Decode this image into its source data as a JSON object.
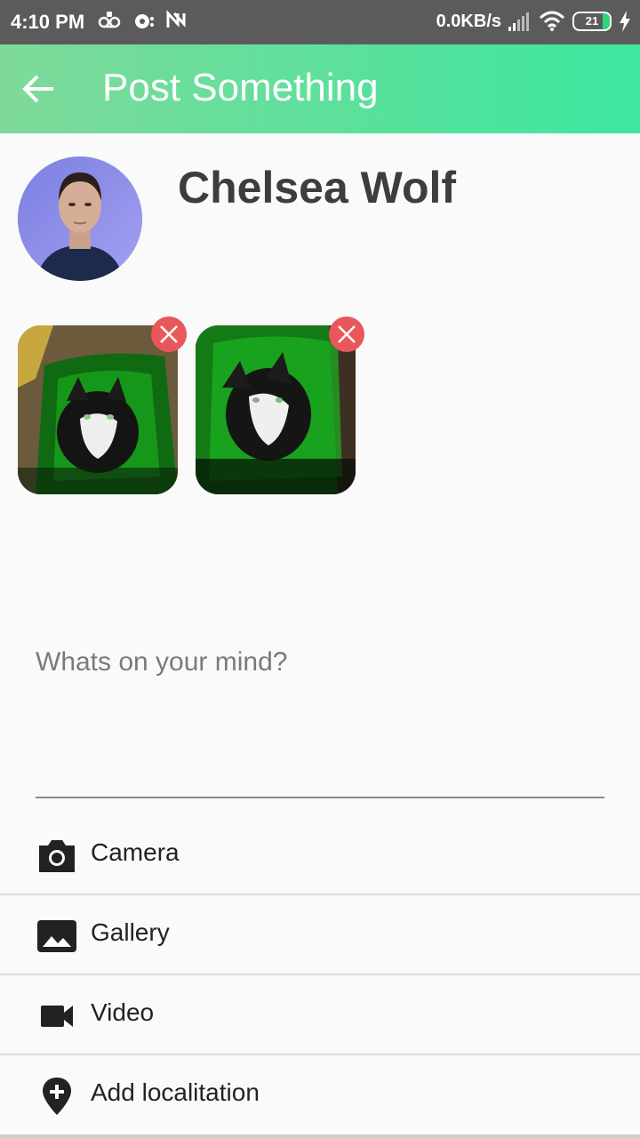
{
  "status_bar": {
    "time": "4:10 PM",
    "network_speed": "0.0KB/s",
    "battery": "21",
    "icons": [
      "voicemail-icon",
      "sync-icon",
      "nfc-icon",
      "signal-icon",
      "wifi-icon",
      "battery-icon",
      "charging-icon"
    ]
  },
  "app_bar": {
    "title": "Post Something",
    "back_icon": "arrow-left-icon",
    "color_start": "#7fd99a",
    "color_end": "#3de79e"
  },
  "user": {
    "name": "Chelsea Wolf"
  },
  "attachments": [
    {
      "type": "image",
      "remove_icon": "close-icon"
    },
    {
      "type": "image",
      "remove_icon": "close-icon"
    }
  ],
  "post": {
    "placeholder": "Whats on your mind?",
    "value": ""
  },
  "actions": [
    {
      "label": "Camera",
      "icon": "camera-icon"
    },
    {
      "label": "Gallery",
      "icon": "image-icon"
    },
    {
      "label": "Video",
      "icon": "videocam-icon"
    },
    {
      "label": "Add localitation",
      "icon": "add-location-icon"
    }
  ],
  "colors": {
    "remove_button": "#e9575b",
    "name_text": "#3d3d3d"
  }
}
